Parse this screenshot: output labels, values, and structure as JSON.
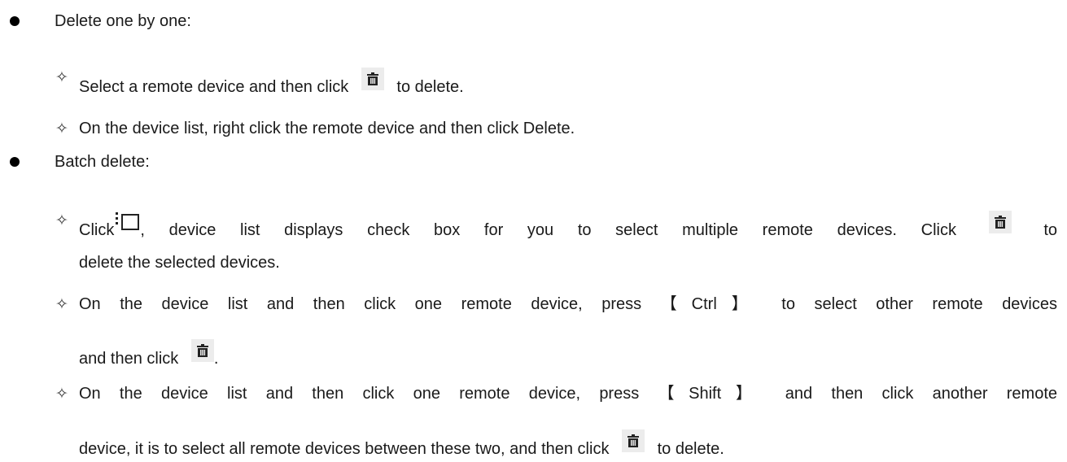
{
  "bullets": [
    {
      "label": "Delete one by one:",
      "items": [
        {
          "before": "Select a remote device and then click",
          "icon": "trash-icon",
          "after": "to delete."
        },
        {
          "text": "On the device list, right click the remote device and then click Delete."
        }
      ]
    },
    {
      "label": "Batch delete:",
      "items": [
        {
          "part1": "Click",
          "icon1": "multi-select-icon",
          "part2": ", device list displays check box for you to select multiple remote devices. Click",
          "icon2": "trash-icon",
          "part3": "to",
          "line2": "delete the selected devices."
        },
        {
          "line1": "On the device list and then click one remote device, press 【Ctrl】 to select other remote devices",
          "line2_before": "and then click",
          "icon": "trash-icon",
          "line2_after": "."
        },
        {
          "line1": "On the device list and then click one remote device, press 【Shift】 and then click another remote",
          "line2_before": "device, it is to select all remote devices between these two, and then click",
          "icon": "trash-icon",
          "line2_after": "to delete."
        }
      ]
    }
  ]
}
